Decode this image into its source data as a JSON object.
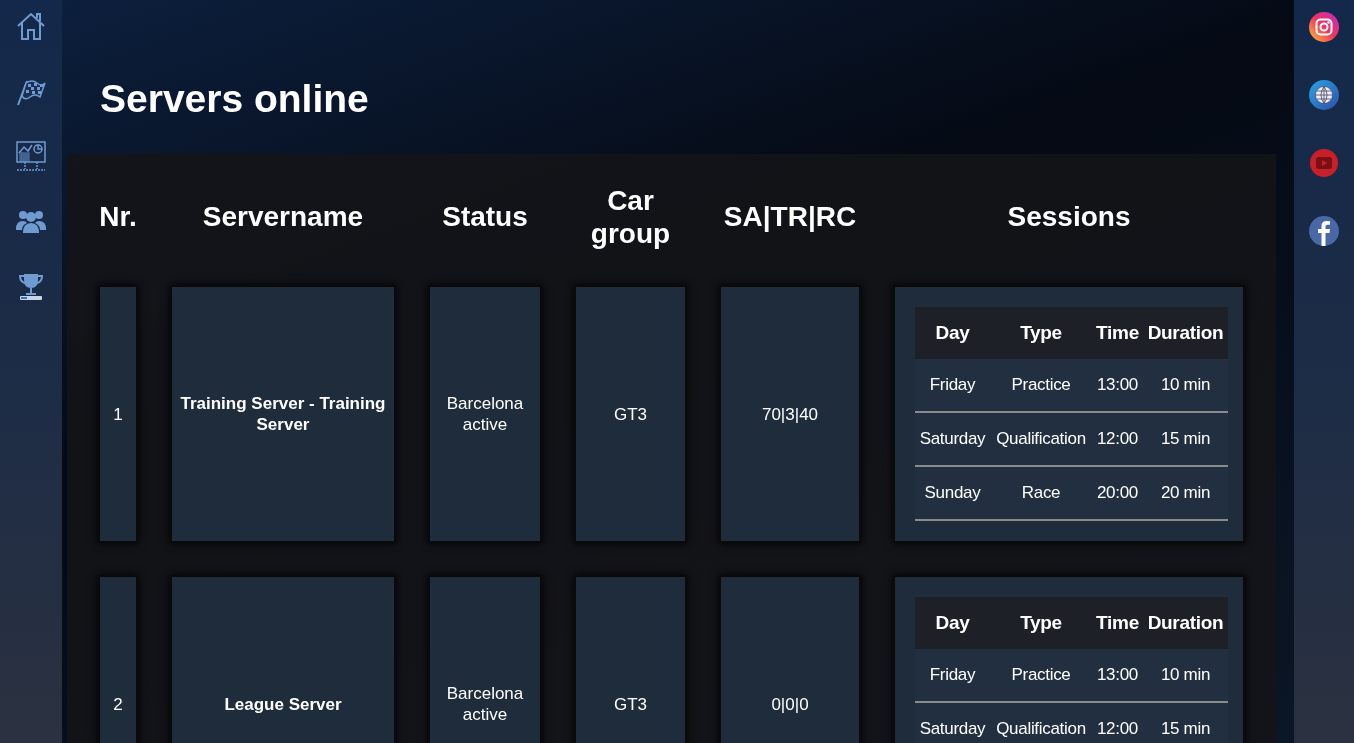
{
  "page_title": "Servers online",
  "table": {
    "columns": [
      "Nr.",
      "Servername",
      "Status",
      "Car group",
      "SA|TR|RC",
      "Sessions"
    ],
    "rows": [
      {
        "nr": "1",
        "servername": "Training Server - Training Server",
        "status": "Barcelona active",
        "car_group": "GT3",
        "sa_tr_rc": "70|3|40",
        "sessions": {
          "columns": [
            "Day",
            "Type",
            "Time",
            "Duration"
          ],
          "rows": [
            [
              "Friday",
              "Practice",
              "13:00",
              "10 min"
            ],
            [
              "Saturday",
              "Qualification",
              "12:00",
              "15 min"
            ],
            [
              "Sunday",
              "Race",
              "20:00",
              "20 min"
            ]
          ]
        }
      },
      {
        "nr": "2",
        "servername": "League Server",
        "status": "Barcelona active",
        "car_group": "GT3",
        "sa_tr_rc": "0|0|0",
        "sessions": {
          "columns": [
            "Day",
            "Type",
            "Time",
            "Duration"
          ],
          "rows": [
            [
              "Friday",
              "Practice",
              "13:00",
              "10 min"
            ],
            [
              "Saturday",
              "Qualification",
              "12:00",
              "15 min"
            ]
          ]
        }
      }
    ]
  }
}
